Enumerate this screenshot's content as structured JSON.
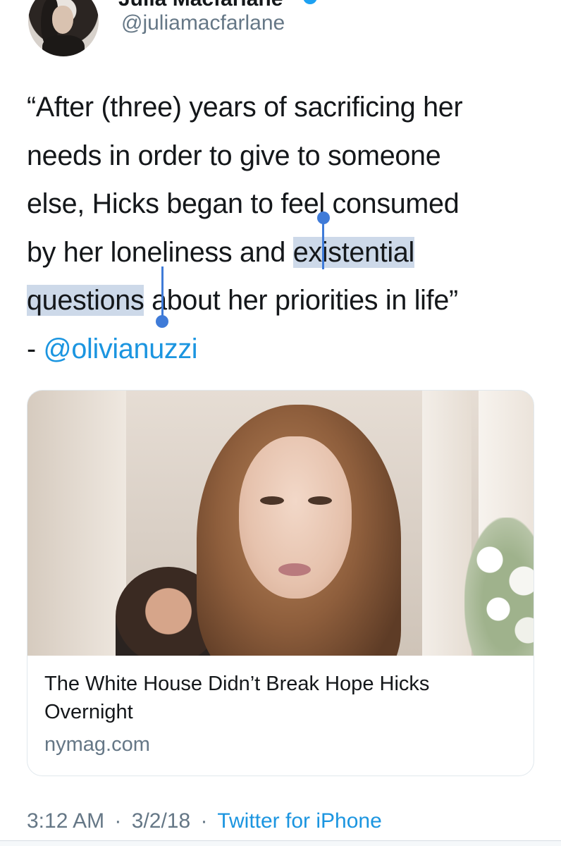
{
  "tweet": {
    "author": {
      "display_name": "Julia Macfarlane",
      "handle": "@juliamacfarlane"
    },
    "text_lines": [
      "“After (three) years of sacrificing her",
      "needs in order to give to someone",
      "else, Hicks began to feel consumed"
    ],
    "line4_pre": "by her loneliness and ",
    "line4_sel": "existential",
    "line5_sel": "questions",
    "line5_post": " about her priorities in life”",
    "line6_prefix": "- ",
    "mention": "@olivianuzzi",
    "card": {
      "title": "The White House Didn’t Break Hope Hicks Overnight",
      "domain": "nymag.com"
    },
    "timestamp": {
      "time": "3:12 AM",
      "separator": "·",
      "date": "3/2/18",
      "source": "Twitter for iPhone"
    }
  },
  "colors": {
    "link": "#1b95e0",
    "selection": "#cdd9e9",
    "selection_handle": "#3f7bd8",
    "secondary_text": "#657786"
  }
}
